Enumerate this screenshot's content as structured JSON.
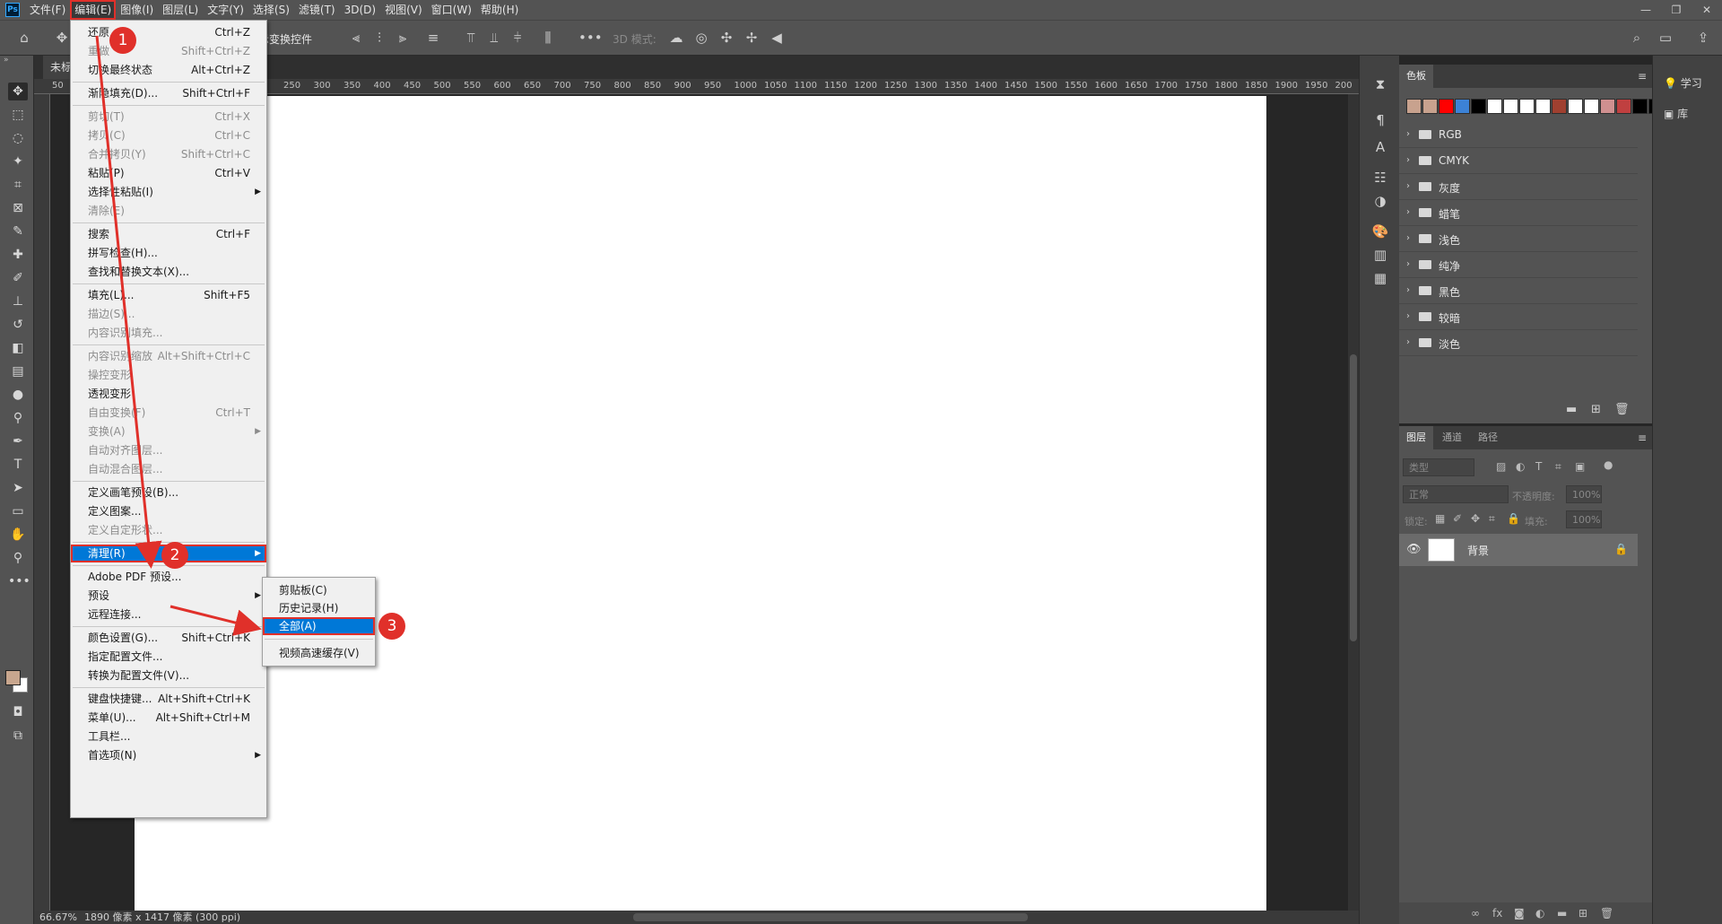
{
  "menubar": {
    "logo": "Ps",
    "items": [
      "文件(F)",
      "编辑(E)",
      "图像(I)",
      "图层(L)",
      "文字(Y)",
      "选择(S)",
      "滤镜(T)",
      "3D(D)",
      "视图(V)",
      "窗口(W)",
      "帮助(H)"
    ],
    "window_controls": [
      "—",
      "❐",
      "✕"
    ]
  },
  "optbar": {
    "show_transform_controls": "示变换控件",
    "mode_3d": "3D 模式:"
  },
  "document": {
    "tab_label": "未标",
    "ruler_ticks": [
      "50",
      "250",
      "300",
      "350",
      "400",
      "450",
      "500",
      "550",
      "600",
      "650",
      "700",
      "750",
      "800",
      "850",
      "900",
      "950",
      "1000",
      "1050",
      "1100",
      "1150",
      "1200",
      "1250",
      "1300",
      "1350",
      "1400",
      "1450",
      "1500",
      "1550",
      "1600",
      "1650",
      "1700",
      "1750",
      "1800",
      "1850",
      "1900",
      "1950",
      "200"
    ]
  },
  "status": {
    "zoom": "66.67%",
    "doc_info": "1890 像素 x 1417 像素 (300 ppi)"
  },
  "edit_menu": {
    "items": [
      {
        "label": "还原",
        "shortcut": "Ctrl+Z",
        "disabled": false
      },
      {
        "label": "重做",
        "shortcut": "Shift+Ctrl+Z",
        "disabled": true
      },
      {
        "label": "切换最终状态",
        "shortcut": "Alt+Ctrl+Z",
        "disabled": false
      },
      {
        "label": "渐隐填充(D)...",
        "shortcut": "Shift+Ctrl+F",
        "disabled": false
      },
      {
        "label": "剪切(T)",
        "shortcut": "Ctrl+X",
        "disabled": true
      },
      {
        "label": "拷贝(C)",
        "shortcut": "Ctrl+C",
        "disabled": true
      },
      {
        "label": "合并拷贝(Y)",
        "shortcut": "Shift+Ctrl+C",
        "disabled": true
      },
      {
        "label": "粘贴(P)",
        "shortcut": "Ctrl+V",
        "disabled": false
      },
      {
        "label": "选择性粘贴(I)",
        "shortcut": "",
        "disabled": false
      },
      {
        "label": "清除(E)",
        "shortcut": "",
        "disabled": true
      },
      {
        "label": "搜索",
        "shortcut": "Ctrl+F",
        "disabled": false
      },
      {
        "label": "拼写检查(H)...",
        "shortcut": "",
        "disabled": false
      },
      {
        "label": "查找和替换文本(X)...",
        "shortcut": "",
        "disabled": false
      },
      {
        "label": "填充(L)...",
        "shortcut": "Shift+F5",
        "disabled": false
      },
      {
        "label": "描边(S)...",
        "shortcut": "",
        "disabled": true
      },
      {
        "label": "内容识别填充...",
        "shortcut": "",
        "disabled": true
      },
      {
        "label": "内容识别缩放",
        "shortcut": "Alt+Shift+Ctrl+C",
        "disabled": true
      },
      {
        "label": "操控变形",
        "shortcut": "",
        "disabled": true
      },
      {
        "label": "透视变形",
        "shortcut": "",
        "disabled": false
      },
      {
        "label": "自由变换(F)",
        "shortcut": "Ctrl+T",
        "disabled": true
      },
      {
        "label": "变换(A)",
        "shortcut": "",
        "disabled": true
      },
      {
        "label": "自动对齐图层...",
        "shortcut": "",
        "disabled": true
      },
      {
        "label": "自动混合图层...",
        "shortcut": "",
        "disabled": true
      },
      {
        "label": "定义画笔预设(B)...",
        "shortcut": "",
        "disabled": false
      },
      {
        "label": "定义图案...",
        "shortcut": "",
        "disabled": false
      },
      {
        "label": "定义自定形状...",
        "shortcut": "",
        "disabled": true
      },
      {
        "label": "清理(R)",
        "shortcut": "",
        "disabled": false
      },
      {
        "label": "Adobe PDF 预设...",
        "shortcut": "",
        "disabled": false
      },
      {
        "label": "预设",
        "shortcut": "",
        "disabled": false
      },
      {
        "label": "远程连接...",
        "shortcut": "",
        "disabled": false
      },
      {
        "label": "颜色设置(G)...",
        "shortcut": "Shift+Ctrl+K",
        "disabled": false
      },
      {
        "label": "指定配置文件...",
        "shortcut": "",
        "disabled": false
      },
      {
        "label": "转换为配置文件(V)...",
        "shortcut": "",
        "disabled": false
      },
      {
        "label": "键盘快捷键...",
        "shortcut": "Alt+Shift+Ctrl+K",
        "disabled": false
      },
      {
        "label": "菜单(U)...",
        "shortcut": "Alt+Shift+Ctrl+M",
        "disabled": false
      },
      {
        "label": "工具栏...",
        "shortcut": "",
        "disabled": false
      },
      {
        "label": "首选项(N)",
        "shortcut": "",
        "disabled": false
      }
    ]
  },
  "purge_submenu": {
    "items": [
      "剪贴板(C)",
      "历史记录(H)",
      "全部(A)",
      "视频高速缓存(V)"
    ]
  },
  "annotations": {
    "step1": "1",
    "step2": "2",
    "step3": "3",
    "color": "#e0302a"
  },
  "swatches_panel": {
    "tab": "色板",
    "recent_colors": [
      "#c8a28e",
      "#c8a28e",
      "#ff0000",
      "#3c82d6",
      "#000000",
      "#ffffff",
      "#ffffff",
      "#ffffff",
      "#ffffff",
      "#a04030",
      "#ffffff",
      "#ffffff",
      "#d09090",
      "#c04040",
      "#000000",
      "#000000",
      "#f0d890"
    ],
    "folders": [
      "RGB",
      "CMYK",
      "灰度",
      "蜡笔",
      "浅色",
      "纯净",
      "黑色",
      "较暗",
      "淡色"
    ]
  },
  "layers_panel": {
    "tabs": [
      "图层",
      "通道",
      "路径"
    ],
    "filter_placeholder": "类型",
    "blend_mode": "正常",
    "opacity_label": "不透明度:",
    "opacity_value": "100%",
    "lock_label": "锁定:",
    "fill_label": "填充:",
    "fill_value": "100%",
    "layer_name": "背景"
  },
  "far_right": {
    "learn": "学习",
    "library": "库"
  }
}
